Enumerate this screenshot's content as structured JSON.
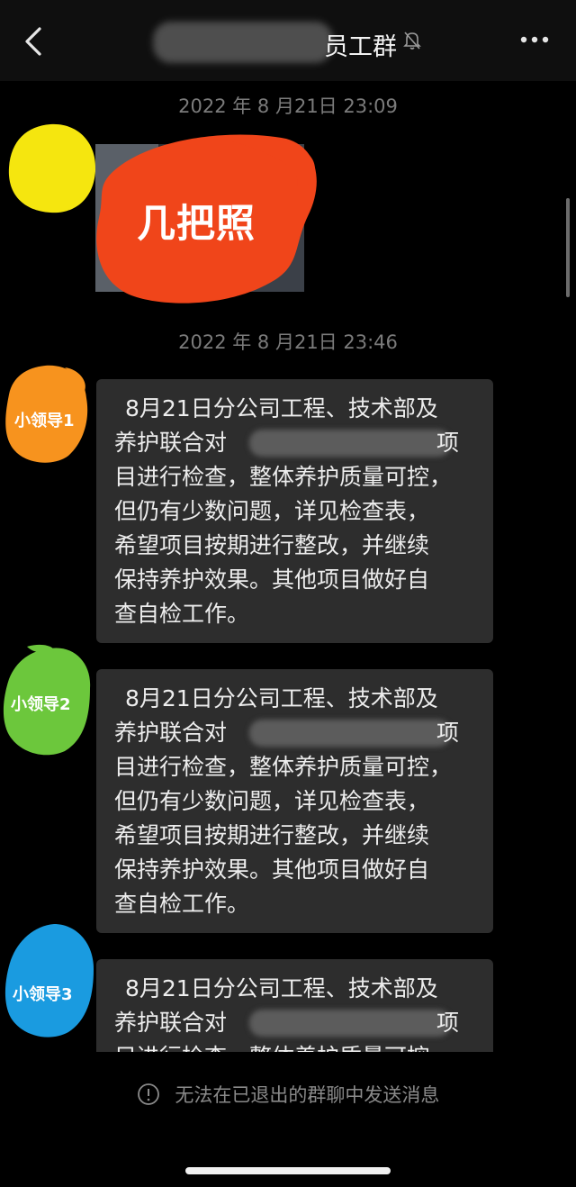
{
  "header": {
    "title": "员工群",
    "back_icon": "chevron-left-icon",
    "mute_icon": "bell-muted-icon",
    "more_icon": "more-dots-icon"
  },
  "messages": {
    "time_1": "2022 年 8 月21日 23:09",
    "time_2": "2022 年 8 月21日 23:46",
    "photo_caption": "几把照",
    "leader_1": "小领导1",
    "leader_2": "小领导2",
    "leader_3": "小领导3",
    "text_lines": [
      "8月21日分公司工程、技术部及",
      "养护联合对",
      "项",
      "目进行检查，整体养护质量可控，",
      "但仍有少数问题，详见检查表，",
      "希望项目按期进行整改，并继续",
      "保持养护效果。其他项目做好自",
      "查自检工作。"
    ]
  },
  "footer": {
    "notice": "无法在已退出的群聊中发送消息",
    "notice_icon": "info-circle-icon"
  },
  "colors": {
    "avatar_1": "#f5e60f",
    "avatar_2": "#f7931e",
    "avatar_3": "#6cc73c",
    "avatar_4": "#1a9be0",
    "photo_scribble": "#f0451a",
    "bubble": "#2d2d2d"
  }
}
